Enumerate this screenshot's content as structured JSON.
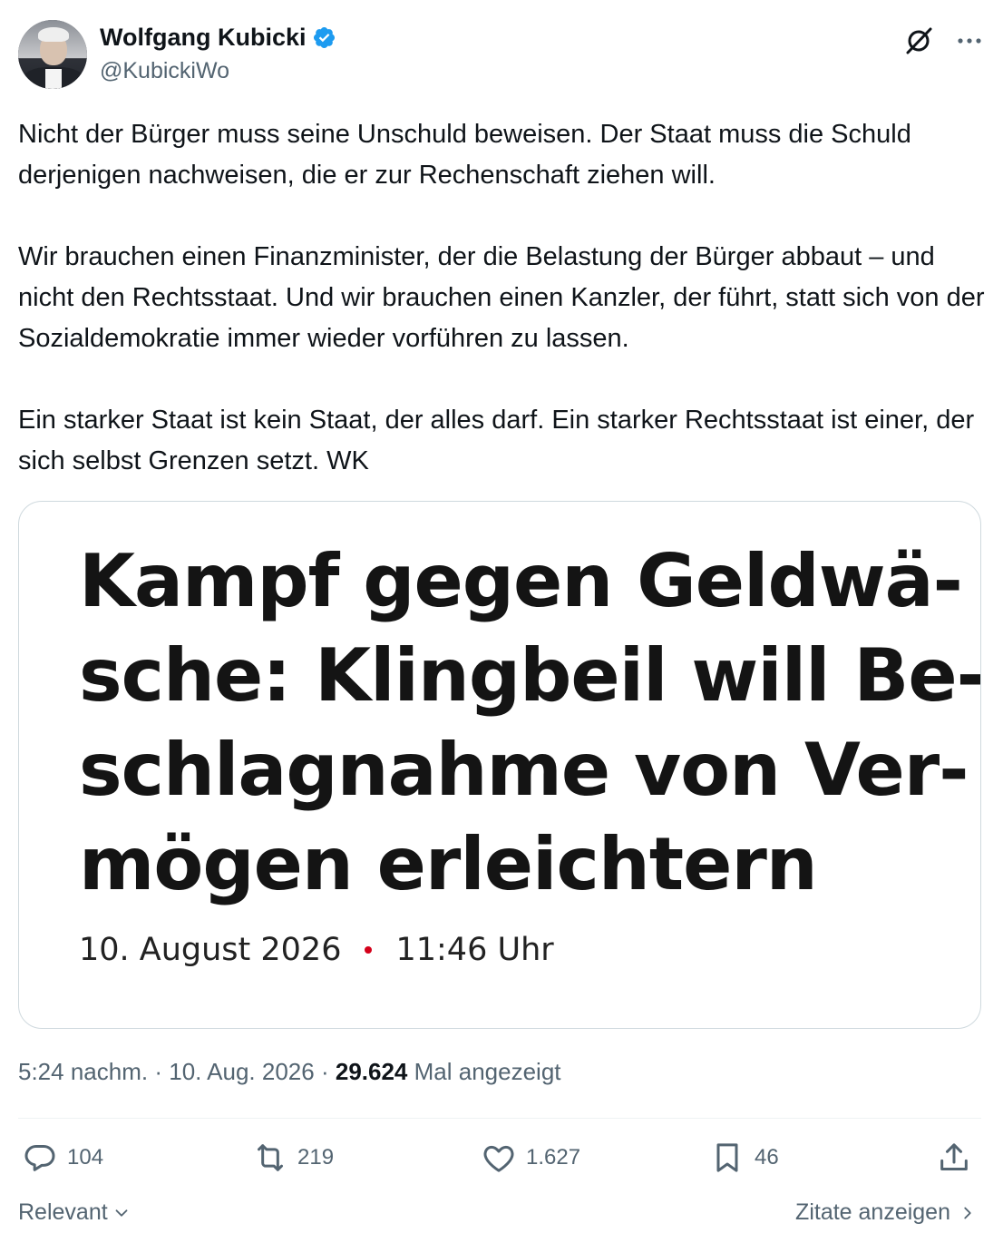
{
  "author": {
    "name": "Wolfgang Kubicki",
    "handle": "@KubickiWo",
    "verified": true
  },
  "icons": {
    "verified": "verified-badge-icon",
    "grok": "grok-icon",
    "more": "more-options-icon",
    "reply": "reply-icon",
    "repost": "repost-icon",
    "like": "like-icon",
    "bookmark": "bookmark-icon",
    "share": "share-icon",
    "chevron": "chevron-icon"
  },
  "colors": {
    "accent": "#1d9bf0",
    "muted": "#536471",
    "text": "#0f1419",
    "headline_dot": "#d4001a"
  },
  "post": {
    "paragraphs": [
      "Nicht der Bürger muss seine Unschuld beweisen. Der Staat muss die Schuld derjenigen nachweisen, die er zur Rechenschaft ziehen will.",
      "Wir brauchen einen Finanzminister, der die Belastung der Bürger abbaut – und nicht den Rechtsstaat. Und wir brauchen einen Kanzler, der führt, statt sich von der Sozialdemokratie immer wieder vorführen zu lassen.",
      "Ein starker Staat ist kein Staat, der alles darf. Ein starker Rechtsstaat ist einer, der sich selbst Grenzen setzt. WK"
    ]
  },
  "media": {
    "headline_lines": [
      "Kampf gegen Geldwä-",
      "sche: Klingbeil will Be-",
      "schlagnahme von Ver-",
      "mögen erleichtern"
    ],
    "date": "10. August 2026",
    "time": "11:46 Uhr"
  },
  "meta": {
    "time": "5:24 nachm.",
    "separator": "·",
    "date": "10. Aug. 2026",
    "views": "29.624",
    "views_label": "Mal angezeigt"
  },
  "actions": {
    "replies": "104",
    "reposts": "219",
    "likes": "1.627",
    "bookmarks": "46"
  },
  "footer": {
    "sort": "Relevant",
    "quotes": "Zitate anzeigen"
  }
}
